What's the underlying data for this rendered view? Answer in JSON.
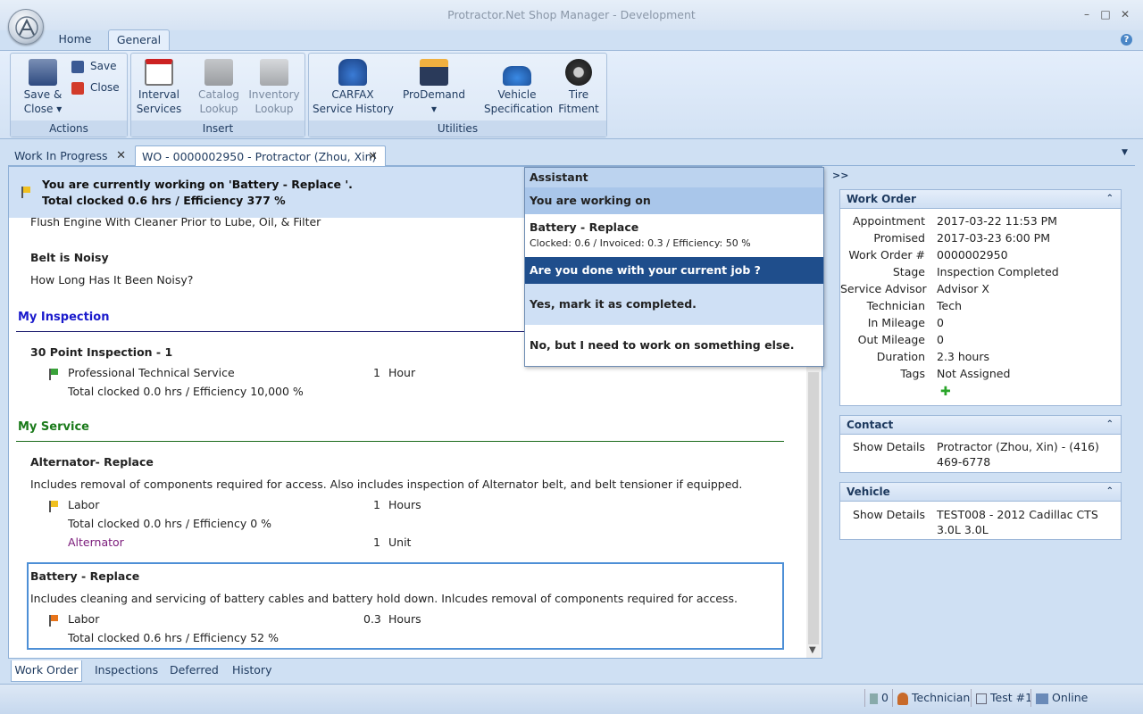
{
  "app": {
    "title": "Protractor.Net Shop Manager - Development"
  },
  "ribbon": {
    "tabs": [
      "Home",
      "General"
    ],
    "groups": [
      {
        "caption": "Actions",
        "buttons": [
          "Save &\nClose ▾",
          "Save",
          "Close"
        ]
      },
      {
        "caption": "Insert",
        "buttons": [
          "Interval\nServices",
          "Catalog\nLookup",
          "Inventory\nLookup"
        ]
      },
      {
        "caption": "Utilities",
        "buttons": [
          "CARFAX\nService History",
          "ProDemand\n▾",
          "Vehicle\nSpecification",
          "Tire\nFitment"
        ]
      }
    ]
  },
  "doc_tabs": [
    "Work In Progress",
    "WO - 0000002950 - Protractor (Zhou, Xin)"
  ],
  "banner": {
    "line1": "You are currently working on 'Battery - Replace '.",
    "line2": "Total clocked 0.6 hrs / Efficiency 377 %"
  },
  "content": {
    "flush_line": "Flush Engine With Cleaner Prior to Lube, Oil, & Filter",
    "belt_title": "Belt is Noisy",
    "belt_question": "How Long Has It Been Noisy?",
    "inspection_header": "My Inspection",
    "inspection_item": "30 Point Inspection - 1",
    "inspection_labor": "Professional Technical Service",
    "inspection_qty": "1",
    "inspection_unit": "Hour",
    "inspection_clocked": "Total clocked 0.0 hrs / Efficiency 10,000 %",
    "service_header": "My Service",
    "alt_title": "Alternator- Replace",
    "alt_desc": "Includes removal of components required for access. Also includes inspection of Alternator belt, and belt tensioner if equipped.",
    "alt_labor": "Labor",
    "alt_labor_qty": "1",
    "alt_labor_unit": "Hours",
    "alt_clocked": "Total clocked 0.0 hrs / Efficiency 0 %",
    "alt_part": "Alternator",
    "alt_part_qty": "1",
    "alt_part_unit": "Unit",
    "bat_title": "Battery - Replace",
    "bat_desc": "Includes cleaning and servicing of battery cables and battery hold down. Inlcudes removal of components required for access.",
    "bat_labor": "Labor",
    "bat_labor_qty": "0.3",
    "bat_labor_unit": "Hours",
    "bat_clocked": "Total clocked 0.6 hrs / Efficiency 52 %"
  },
  "assistant": {
    "title": "Assistant",
    "working_on": "You are working on",
    "job": "Battery - Replace",
    "job_stats": "Clocked: 0.6 / Invoiced: 0.3 / Efficiency: 50 %",
    "question": "Are you done with your current job ?",
    "yes": "Yes, mark it as completed.",
    "no": "No, but I need to work on something else."
  },
  "bottom_tabs": [
    "Work Order",
    "Inspections",
    "Deferred",
    "History"
  ],
  "right": {
    "expand": ">>",
    "work_order": {
      "title": "Work Order",
      "rows": [
        {
          "label": "Appointment",
          "value": "2017-03-22 11:53 PM"
        },
        {
          "label": "Promised",
          "value": "2017-03-23 6:00 PM"
        },
        {
          "label": "Work Order #",
          "value": "0000002950"
        },
        {
          "label": "Stage",
          "value": "Inspection Completed"
        },
        {
          "label": "Service Advisor",
          "value": "Advisor X"
        },
        {
          "label": "Technician",
          "value": "Tech"
        },
        {
          "label": "In Mileage",
          "value": "0"
        },
        {
          "label": "Out Mileage",
          "value": "0"
        },
        {
          "label": "Duration",
          "value": "2.3 hours"
        },
        {
          "label": "Tags",
          "value": "Not Assigned"
        }
      ]
    },
    "contact": {
      "title": "Contact",
      "label": "Show Details",
      "value1": "Protractor (Zhou, Xin) - (416)",
      "value2": "469-6778"
    },
    "vehicle": {
      "title": "Vehicle",
      "label": "Show Details",
      "value1": "TEST008 - 2012 Cadillac CTS",
      "value2": "3.0L 3.0L"
    }
  },
  "status": {
    "count": "0",
    "user": "Technician",
    "location": "Test #1",
    "connection": "Online"
  },
  "colors": {
    "accent": "#1a4a8a",
    "inspection": "#1a1acc",
    "service": "#1a7a1a",
    "part_link": "#7a1a7a"
  }
}
